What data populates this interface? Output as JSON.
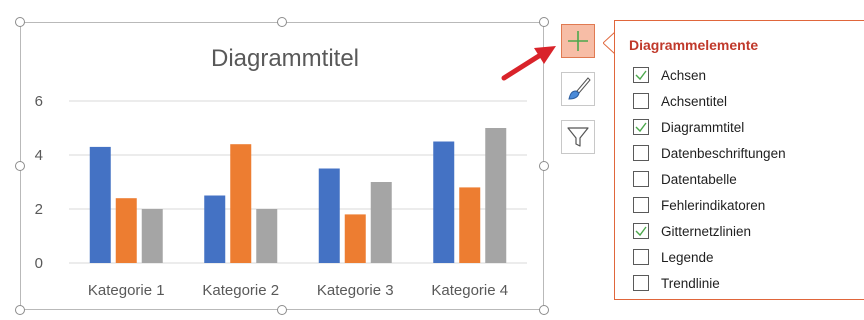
{
  "chart": {
    "title": "Diagrammtitel"
  },
  "chart_data": {
    "type": "bar",
    "title": "Diagrammtitel",
    "categories": [
      "Kategorie 1",
      "Kategorie 2",
      "Kategorie 3",
      "Kategorie 4"
    ],
    "series": [
      {
        "values": [
          4.3,
          2.5,
          3.5,
          4.5
        ],
        "color": "#4472c4"
      },
      {
        "values": [
          2.4,
          4.4,
          1.8,
          2.8
        ],
        "color": "#ed7d31"
      },
      {
        "values": [
          2.0,
          2.0,
          3.0,
          5.0
        ],
        "color": "#a5a5a5"
      }
    ],
    "yticks": [
      "0",
      "2",
      "4",
      "6"
    ],
    "ylim": [
      0,
      6
    ],
    "grid": true
  },
  "buttons": {
    "elements_icon": "plus-icon",
    "styles_icon": "paintbrush-icon",
    "filter_icon": "funnel-icon"
  },
  "panel": {
    "title": "Diagrammelemente",
    "items": [
      {
        "label": "Achsen",
        "checked": true
      },
      {
        "label": "Achsentitel",
        "checked": false
      },
      {
        "label": "Diagrammtitel",
        "checked": true
      },
      {
        "label": "Datenbeschriftungen",
        "checked": false
      },
      {
        "label": "Datentabelle",
        "checked": false
      },
      {
        "label": "Fehlerindikatoren",
        "checked": false
      },
      {
        "label": "Gitternetzlinien",
        "checked": true
      },
      {
        "label": "Legende",
        "checked": false
      },
      {
        "label": "Trendlinie",
        "checked": false
      }
    ]
  },
  "colors": {
    "accent": "#e0663b",
    "panel_title": "#c0392b",
    "check": "#4ca84c",
    "arrow": "#d9232a"
  }
}
